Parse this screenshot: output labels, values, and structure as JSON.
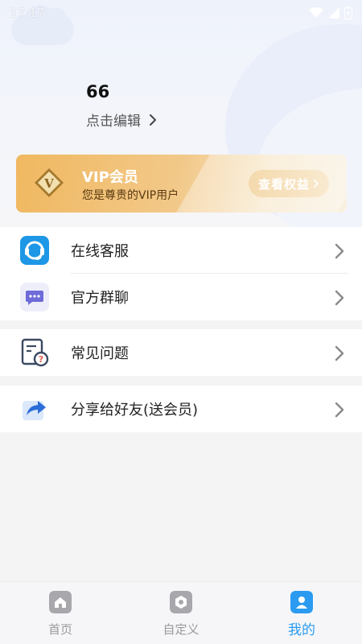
{
  "status_bar": {
    "time": "17:17"
  },
  "profile": {
    "username": "66",
    "edit_label": "点击编辑"
  },
  "vip": {
    "badge_letter": "V",
    "title": "VIP会员",
    "description": "您是尊贵的VIP用户",
    "button_label": "查看权益"
  },
  "menu": {
    "customer_service": {
      "label": "在线客服",
      "icon": "headset-icon"
    },
    "group_chat": {
      "label": "官方群聊",
      "icon": "chat-bubble-icon"
    },
    "faq": {
      "label": "常见问题",
      "icon": "faq-document-icon"
    },
    "share": {
      "label": "分享给好友(送会员)",
      "icon": "share-icon"
    }
  },
  "tabbar": {
    "home": {
      "label": "首页",
      "icon": "home-icon"
    },
    "custom": {
      "label": "自定义",
      "icon": "custom-icon"
    },
    "mine": {
      "label": "我的",
      "icon": "profile-icon",
      "active": true
    }
  },
  "colors": {
    "vip_gold": "#f0b860",
    "accent_blue": "#2a9bf0",
    "tab_inactive": "#9a9a9e"
  }
}
